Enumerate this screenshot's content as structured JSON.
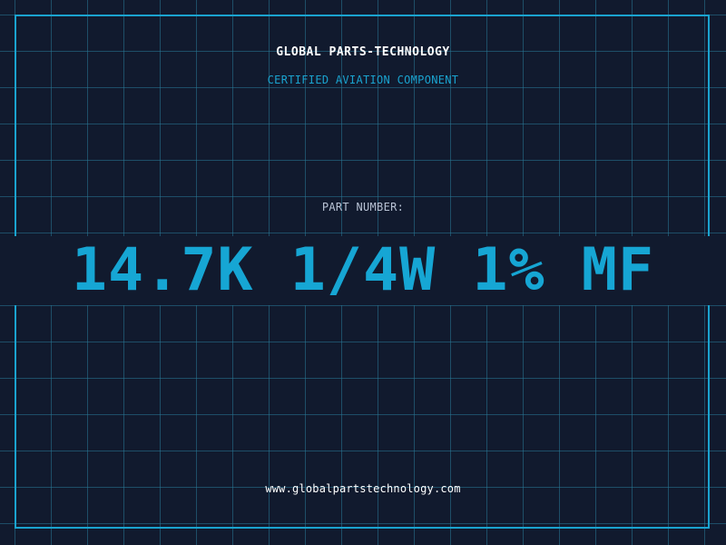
{
  "header": {
    "title": "GLOBAL PARTS-TECHNOLOGY",
    "subtitle": "CERTIFIED AVIATION COMPONENT"
  },
  "part": {
    "label": "PART NUMBER:",
    "number": "14.7K 1/4W 1% MF"
  },
  "footer": {
    "website": "www.globalpartstechnology.com"
  },
  "colors": {
    "background": "#111a2e",
    "accent": "#1aa3cf",
    "grid": "#28788f",
    "text": "#ffffff",
    "muted": "#b8c2d4"
  }
}
